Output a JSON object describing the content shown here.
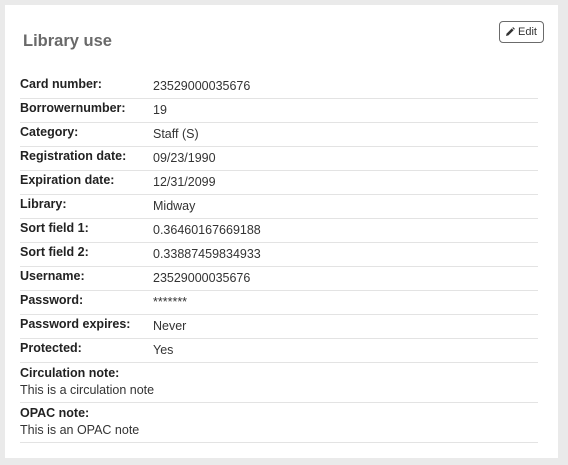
{
  "panel": {
    "title": "Library use",
    "edit_label": "Edit"
  },
  "fields": [
    {
      "label": "Card number:",
      "value": "23529000035676"
    },
    {
      "label": "Borrowernumber:",
      "value": "19"
    },
    {
      "label": "Category:",
      "value": "Staff (S)"
    },
    {
      "label": "Registration date:",
      "value": "09/23/1990"
    },
    {
      "label": "Expiration date:",
      "value": "12/31/2099"
    },
    {
      "label": "Library:",
      "value": "Midway"
    },
    {
      "label": "Sort field 1:",
      "value": "0.36460167669188"
    },
    {
      "label": "Sort field 2:",
      "value": "0.33887459834933"
    },
    {
      "label": "Username:",
      "value": "23529000035676"
    },
    {
      "label": "Password:",
      "value": "*******"
    },
    {
      "label": "Password expires:",
      "value": "Never"
    },
    {
      "label": "Protected:",
      "value": "Yes"
    }
  ],
  "notes": [
    {
      "label": "Circulation note:",
      "value": "This is a circulation note"
    },
    {
      "label": "OPAC note:",
      "value": "This is an OPAC note"
    }
  ],
  "icons": {
    "edit": "pencil-icon"
  }
}
